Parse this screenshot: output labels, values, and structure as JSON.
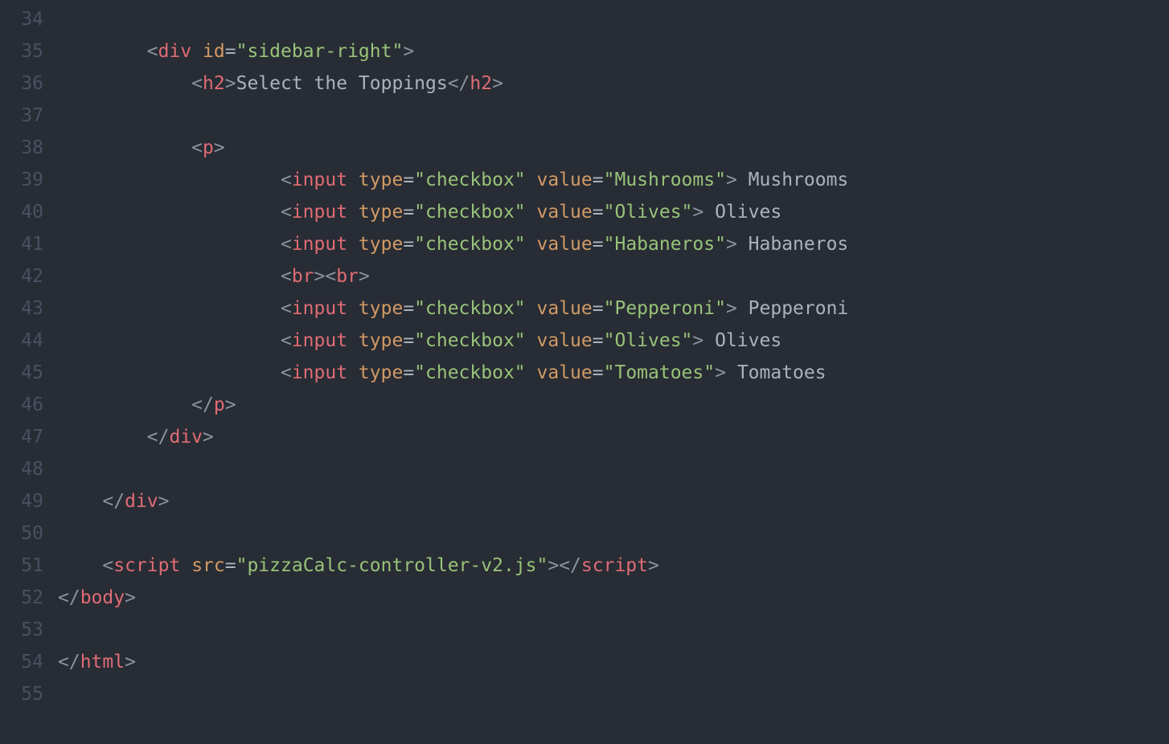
{
  "gutter": {
    "start": 34,
    "end": 55
  },
  "lines": [
    {
      "indent": 0,
      "tokens": []
    },
    {
      "indent": 2,
      "tokens": [
        {
          "c": "bracket",
          "t": "<"
        },
        {
          "c": "tagname",
          "t": "div"
        },
        {
          "c": "text",
          "t": " "
        },
        {
          "c": "attrname",
          "t": "id"
        },
        {
          "c": "punct",
          "t": "="
        },
        {
          "c": "attrval",
          "t": "\"sidebar-right\""
        },
        {
          "c": "bracket",
          "t": ">"
        }
      ]
    },
    {
      "indent": 3,
      "tokens": [
        {
          "c": "bracket",
          "t": "<"
        },
        {
          "c": "tagname",
          "t": "h2"
        },
        {
          "c": "bracket",
          "t": ">"
        },
        {
          "c": "text",
          "t": "Select the Toppings"
        },
        {
          "c": "bracket",
          "t": "</"
        },
        {
          "c": "tagname",
          "t": "h2"
        },
        {
          "c": "bracket",
          "t": ">"
        }
      ]
    },
    {
      "indent": 0,
      "tokens": []
    },
    {
      "indent": 3,
      "tokens": [
        {
          "c": "bracket",
          "t": "<"
        },
        {
          "c": "tagname",
          "t": "p"
        },
        {
          "c": "bracket",
          "t": ">"
        }
      ]
    },
    {
      "indent": 5,
      "tokens": [
        {
          "c": "bracket",
          "t": "<"
        },
        {
          "c": "tagname",
          "t": "input"
        },
        {
          "c": "text",
          "t": " "
        },
        {
          "c": "attrname",
          "t": "type"
        },
        {
          "c": "punct",
          "t": "="
        },
        {
          "c": "attrval",
          "t": "\"checkbox\""
        },
        {
          "c": "text",
          "t": " "
        },
        {
          "c": "attrname",
          "t": "value"
        },
        {
          "c": "punct",
          "t": "="
        },
        {
          "c": "attrval",
          "t": "\"Mushrooms\""
        },
        {
          "c": "bracket",
          "t": ">"
        },
        {
          "c": "text",
          "t": " Mushrooms"
        }
      ]
    },
    {
      "indent": 5,
      "tokens": [
        {
          "c": "bracket",
          "t": "<"
        },
        {
          "c": "tagname",
          "t": "input"
        },
        {
          "c": "text",
          "t": " "
        },
        {
          "c": "attrname",
          "t": "type"
        },
        {
          "c": "punct",
          "t": "="
        },
        {
          "c": "attrval",
          "t": "\"checkbox\""
        },
        {
          "c": "text",
          "t": " "
        },
        {
          "c": "attrname",
          "t": "value"
        },
        {
          "c": "punct",
          "t": "="
        },
        {
          "c": "attrval",
          "t": "\"Olives\""
        },
        {
          "c": "bracket",
          "t": ">"
        },
        {
          "c": "text",
          "t": " Olives"
        }
      ]
    },
    {
      "indent": 5,
      "tokens": [
        {
          "c": "bracket",
          "t": "<"
        },
        {
          "c": "tagname",
          "t": "input"
        },
        {
          "c": "text",
          "t": " "
        },
        {
          "c": "attrname",
          "t": "type"
        },
        {
          "c": "punct",
          "t": "="
        },
        {
          "c": "attrval",
          "t": "\"checkbox\""
        },
        {
          "c": "text",
          "t": " "
        },
        {
          "c": "attrname",
          "t": "value"
        },
        {
          "c": "punct",
          "t": "="
        },
        {
          "c": "attrval",
          "t": "\"Habaneros\""
        },
        {
          "c": "bracket",
          "t": ">"
        },
        {
          "c": "text",
          "t": " Habaneros"
        }
      ]
    },
    {
      "indent": 5,
      "tokens": [
        {
          "c": "bracket",
          "t": "<"
        },
        {
          "c": "tagname",
          "t": "br"
        },
        {
          "c": "bracket",
          "t": ">"
        },
        {
          "c": "bracket",
          "t": "<"
        },
        {
          "c": "tagname",
          "t": "br"
        },
        {
          "c": "bracket",
          "t": ">"
        }
      ]
    },
    {
      "indent": 5,
      "tokens": [
        {
          "c": "bracket",
          "t": "<"
        },
        {
          "c": "tagname",
          "t": "input"
        },
        {
          "c": "text",
          "t": " "
        },
        {
          "c": "attrname",
          "t": "type"
        },
        {
          "c": "punct",
          "t": "="
        },
        {
          "c": "attrval",
          "t": "\"checkbox\""
        },
        {
          "c": "text",
          "t": " "
        },
        {
          "c": "attrname",
          "t": "value"
        },
        {
          "c": "punct",
          "t": "="
        },
        {
          "c": "attrval",
          "t": "\"Pepperoni\""
        },
        {
          "c": "bracket",
          "t": ">"
        },
        {
          "c": "text",
          "t": " Pepperoni"
        }
      ]
    },
    {
      "indent": 5,
      "tokens": [
        {
          "c": "bracket",
          "t": "<"
        },
        {
          "c": "tagname",
          "t": "input"
        },
        {
          "c": "text",
          "t": " "
        },
        {
          "c": "attrname",
          "t": "type"
        },
        {
          "c": "punct",
          "t": "="
        },
        {
          "c": "attrval",
          "t": "\"checkbox\""
        },
        {
          "c": "text",
          "t": " "
        },
        {
          "c": "attrname",
          "t": "value"
        },
        {
          "c": "punct",
          "t": "="
        },
        {
          "c": "attrval",
          "t": "\"Olives\""
        },
        {
          "c": "bracket",
          "t": ">"
        },
        {
          "c": "text",
          "t": " Olives"
        }
      ]
    },
    {
      "indent": 5,
      "tokens": [
        {
          "c": "bracket",
          "t": "<"
        },
        {
          "c": "tagname",
          "t": "input"
        },
        {
          "c": "text",
          "t": " "
        },
        {
          "c": "attrname",
          "t": "type"
        },
        {
          "c": "punct",
          "t": "="
        },
        {
          "c": "attrval",
          "t": "\"checkbox\""
        },
        {
          "c": "text",
          "t": " "
        },
        {
          "c": "attrname",
          "t": "value"
        },
        {
          "c": "punct",
          "t": "="
        },
        {
          "c": "attrval",
          "t": "\"Tomatoes\""
        },
        {
          "c": "bracket",
          "t": ">"
        },
        {
          "c": "text",
          "t": " Tomatoes"
        }
      ]
    },
    {
      "indent": 3,
      "tokens": [
        {
          "c": "bracket",
          "t": "</"
        },
        {
          "c": "tagname",
          "t": "p"
        },
        {
          "c": "bracket",
          "t": ">"
        }
      ]
    },
    {
      "indent": 2,
      "tokens": [
        {
          "c": "bracket",
          "t": "</"
        },
        {
          "c": "tagname",
          "t": "div"
        },
        {
          "c": "bracket",
          "t": ">"
        }
      ]
    },
    {
      "indent": 0,
      "tokens": []
    },
    {
      "indent": 1,
      "tokens": [
        {
          "c": "bracket",
          "t": "</"
        },
        {
          "c": "tagname",
          "t": "div"
        },
        {
          "c": "bracket",
          "t": ">"
        }
      ]
    },
    {
      "indent": 0,
      "tokens": []
    },
    {
      "indent": 1,
      "tokens": [
        {
          "c": "bracket",
          "t": "<"
        },
        {
          "c": "tagname",
          "t": "script"
        },
        {
          "c": "text",
          "t": " "
        },
        {
          "c": "attrname",
          "t": "src"
        },
        {
          "c": "punct",
          "t": "="
        },
        {
          "c": "attrval",
          "t": "\"pizzaCalc-controller-v2.js\""
        },
        {
          "c": "bracket",
          "t": ">"
        },
        {
          "c": "bracket",
          "t": "</"
        },
        {
          "c": "tagname",
          "t": "script"
        },
        {
          "c": "bracket",
          "t": ">"
        }
      ]
    },
    {
      "indent": 0,
      "tokens": [
        {
          "c": "bracket",
          "t": "</"
        },
        {
          "c": "tagname",
          "t": "body"
        },
        {
          "c": "bracket",
          "t": ">"
        }
      ]
    },
    {
      "indent": 0,
      "tokens": []
    },
    {
      "indent": 0,
      "tokens": [
        {
          "c": "bracket",
          "t": "</"
        },
        {
          "c": "tagname",
          "t": "html"
        },
        {
          "c": "bracket",
          "t": ">"
        }
      ]
    },
    {
      "indent": 0,
      "tokens": []
    }
  ]
}
